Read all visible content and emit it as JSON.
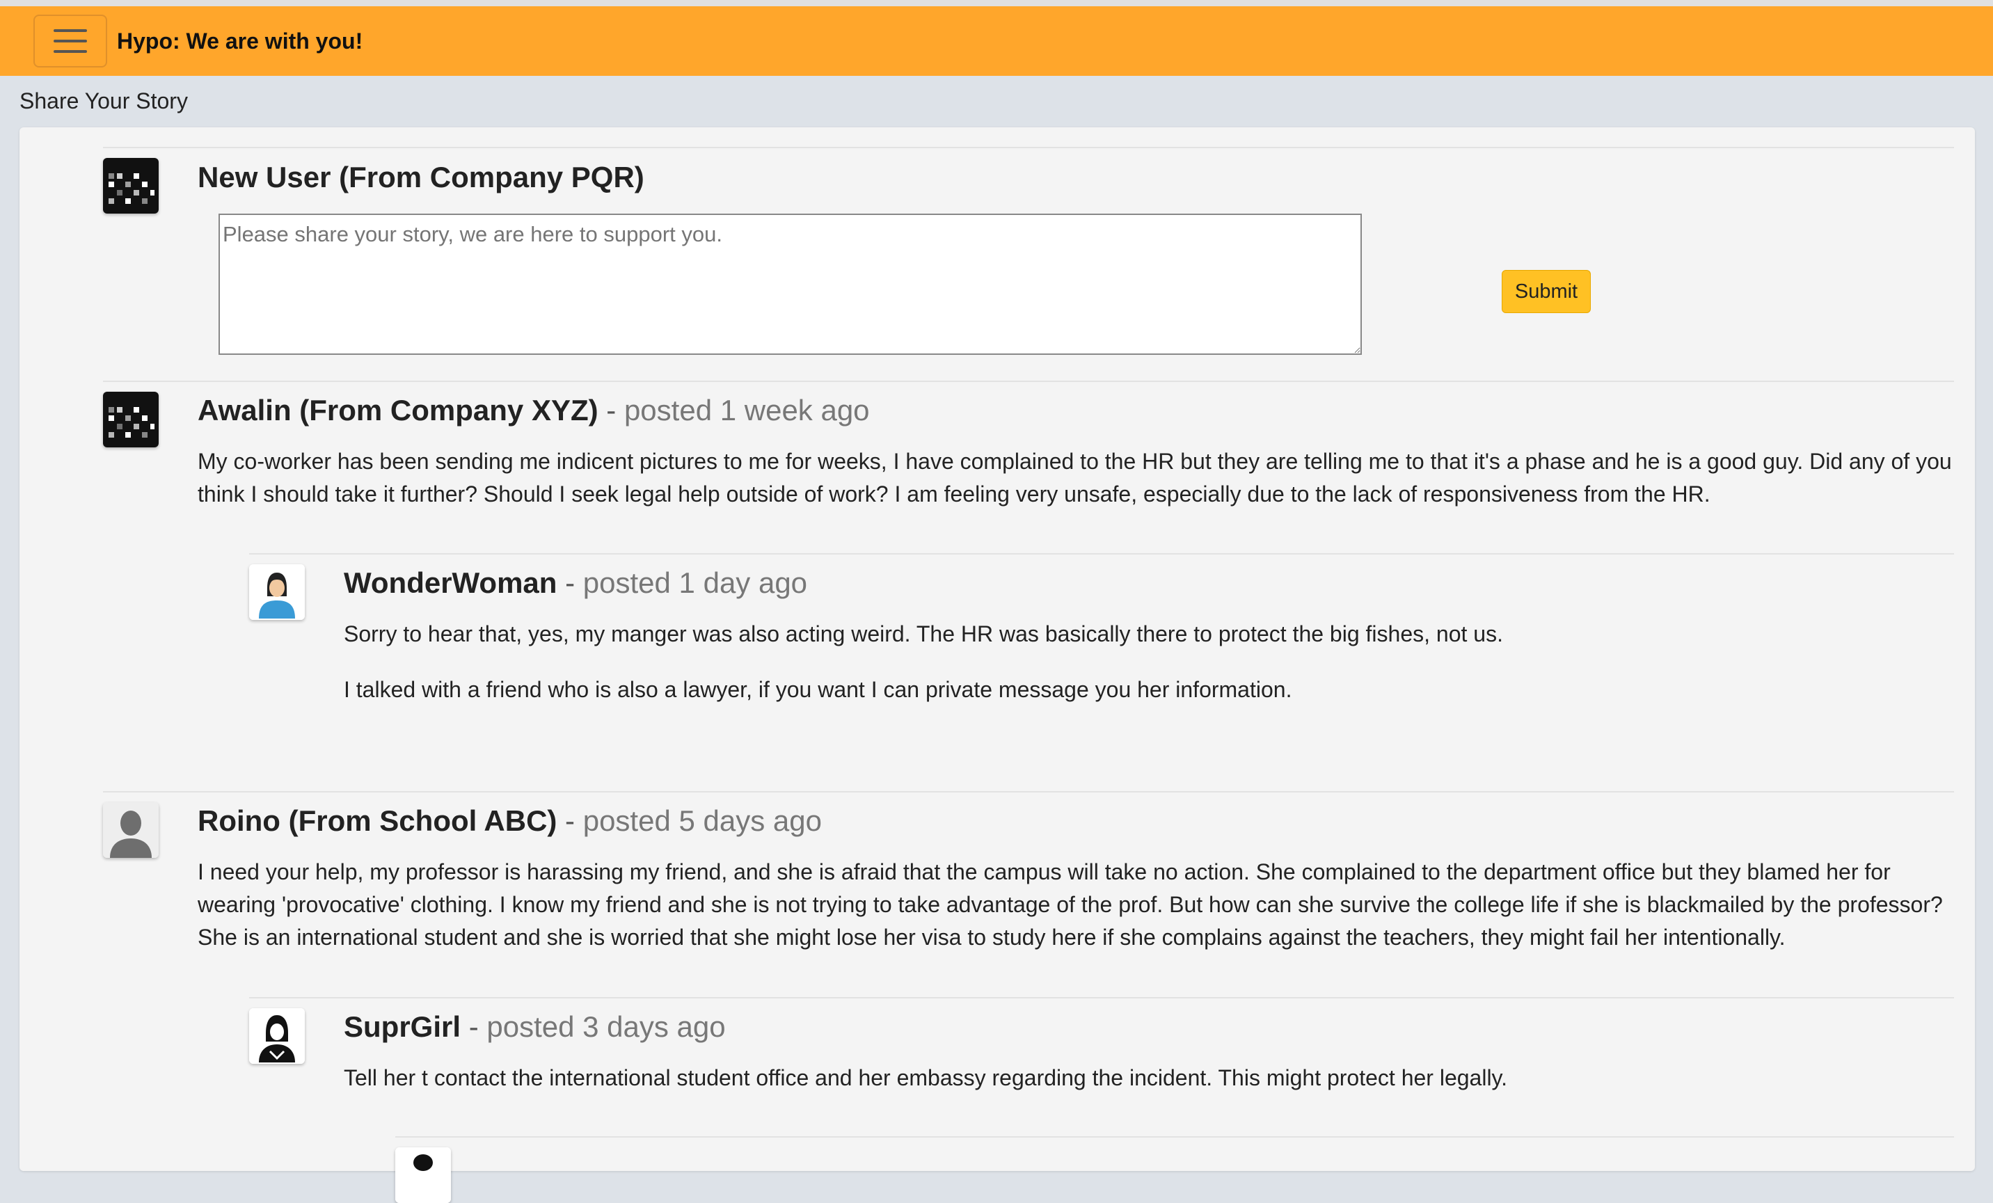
{
  "navbar": {
    "brand": "Hypo: We are with you!"
  },
  "page": {
    "title": "Share Your Story"
  },
  "composer": {
    "user": "New User (From Company PQR)",
    "placeholder": "Please share your story, we are here to support you.",
    "submit_label": "Submit"
  },
  "posts": [
    {
      "author": "Awalin (From Company XYZ)",
      "separator": " - ",
      "meta": "posted 1 week ago",
      "body": "My co-worker has been sending me indicent pictures to me for weeks, I have complained to the HR but they are telling me to that it's a phase and he is a good guy. Did any of you think I should take it further? Should I seek legal help outside of work? I am feeling very unsafe, especially due to the lack of responsiveness from the HR.",
      "avatar_icon": "pixel-grid-avatar-icon",
      "replies": [
        {
          "author": "WonderWoman",
          "separator": " - ",
          "meta": "posted 1 day ago",
          "body_lines": [
            "Sorry to hear that, yes, my manger was also acting weird. The HR was basically there to protect the big fishes, not us.",
            "I talked with a friend who is also a lawyer, if you want I can private message you her information."
          ],
          "avatar_icon": "woman-avatar-icon"
        }
      ]
    },
    {
      "author": "Roino (From School ABC)",
      "separator": " - ",
      "meta": "posted 5 days ago",
      "body": "I need your help, my professor is harassing my friend, and she is afraid that the campus will take no action. She complained to the department office but they blamed her for wearing 'provocative' clothing. I know my friend and she is not trying to take advantage of the prof. But how can she survive the college life if she is blackmailed by the professor? She is an international student and she is worried that she might lose her visa to study here if she complains against the teachers, they might fail her intentionally.",
      "avatar_icon": "person-silhouette-icon",
      "replies": [
        {
          "author": "SuprGirl",
          "separator": " - ",
          "meta": "posted 3 days ago",
          "body_lines": [
            "Tell her t contact the international student office and her embassy regarding the incident. This might protect her legally."
          ],
          "avatar_icon": "woman-silhouette-icon"
        }
      ]
    }
  ],
  "colors": {
    "navbar": "#ffa62b",
    "submit": "#ffc124",
    "page_bg": "#dde2e8",
    "card_bg": "#f4f4f4"
  }
}
